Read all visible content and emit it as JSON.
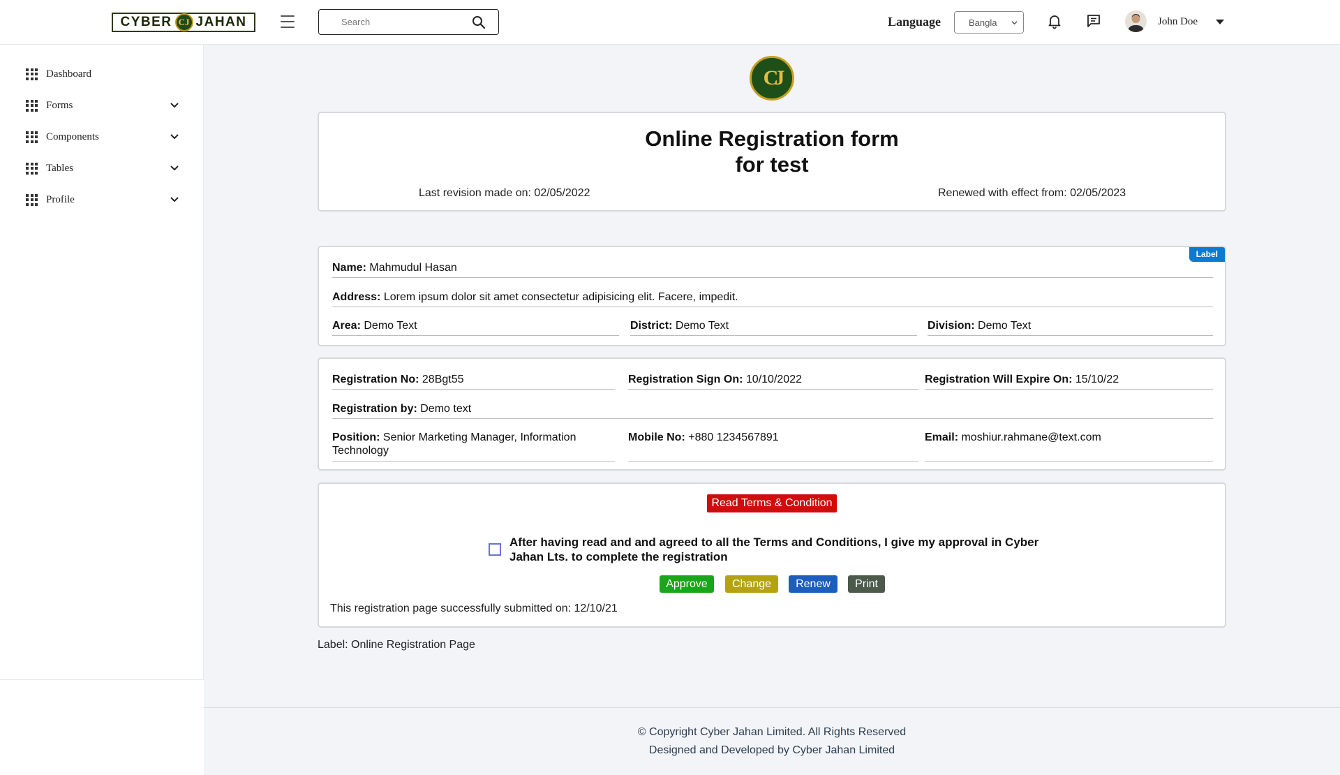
{
  "header": {
    "logo_left": "CYBER",
    "logo_mark": "CJ",
    "logo_right": "JAHAN",
    "search_placeholder": "Search",
    "language_label": "Language",
    "language_value": "Bangla",
    "user_name": "John Doe"
  },
  "sidebar": {
    "items": [
      {
        "label": "Dashboard"
      },
      {
        "label": "Forms"
      },
      {
        "label": "Components"
      },
      {
        "label": "Tables"
      },
      {
        "label": "Profile"
      }
    ]
  },
  "form_header": {
    "seal": "CJ",
    "title_line1": "Online Registration form",
    "title_line2": "for test",
    "last_revision": "Last revision made on: 02/05/2022",
    "renewed": "Renewed with effect from: 02/05/2023"
  },
  "personal": {
    "badge": "Label",
    "name_label": "Name:",
    "name_value": "Mahmudul Hasan",
    "address_label": "Address:",
    "address_value": "Lorem ipsum dolor sit amet consectetur adipisicing elit. Facere, impedit.",
    "area_label": "Area:",
    "area_value": "Demo Text",
    "district_label": "District:",
    "district_value": "Demo Text",
    "division_label": "Division:",
    "division_value": "Demo Text"
  },
  "registration": {
    "reg_no_label": "Registration No:",
    "reg_no_value": "28Bgt55",
    "sign_on_label": "Registration Sign On:",
    "sign_on_value": "10/10/2022",
    "expire_label": "Registration Will Expire On:",
    "expire_value": "15/10/22",
    "by_label": "Registration by:",
    "by_value": "Demo text",
    "position_label": "Position:",
    "position_value": "Senior Marketing Manager, Information Technology",
    "mobile_label": "Mobile No:",
    "mobile_value": "+880 1234567891",
    "email_label": "Email:",
    "email_value": "moshiur.rahmane@text.com"
  },
  "terms": {
    "read_button": "Read Terms & Condition",
    "agreement": "After having read and and agreed to all the Terms and Conditions, I give my approval in Cyber Jahan Lts. to complete the registration",
    "approve": "Approve",
    "change": "Change",
    "renew": "Renew",
    "print": "Print",
    "submitted": "This registration page successfully submitted on: 12/10/21"
  },
  "page_label": "Label: Online Registration Page",
  "footer": {
    "copyright": "© Copyright Cyber Jahan Limited. All Rights Reserved",
    "designed": "Designed and Developed by Cyber Jahan Limited"
  },
  "colors": {
    "approve": "#1aa61a",
    "change": "#b4a30f",
    "renew": "#1b5ebf",
    "print": "#4b5a4b",
    "terms": "#d00c0c",
    "badge": "#0b7ad0"
  }
}
